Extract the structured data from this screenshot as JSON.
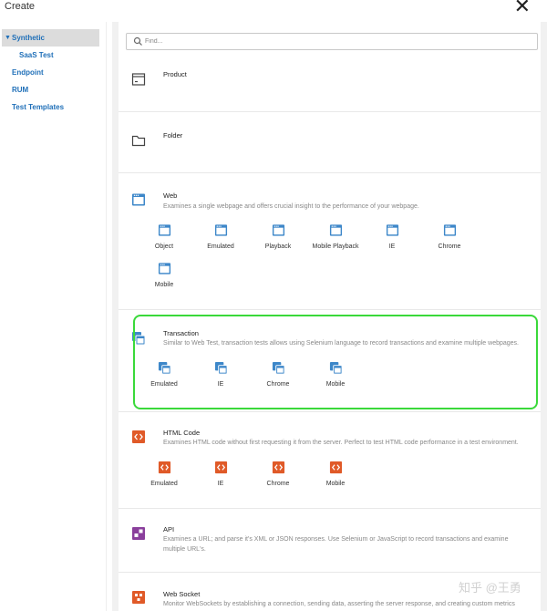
{
  "window": {
    "title": "Create"
  },
  "sidebar": {
    "items": [
      {
        "label": "Synthetic"
      },
      {
        "label": "SaaS Test"
      },
      {
        "label": "Endpoint"
      },
      {
        "label": "RUM"
      },
      {
        "label": "Test Templates"
      }
    ]
  },
  "search": {
    "placeholder": "Find..."
  },
  "sections": {
    "product": {
      "title": "Product"
    },
    "folder": {
      "title": "Folder"
    },
    "web": {
      "title": "Web",
      "description": "Examines a single webpage and offers crucial insight to the performance of your webpage.",
      "tiles": [
        "Object",
        "Emulated",
        "Playback",
        "Mobile Playback",
        "IE",
        "Chrome",
        "Mobile"
      ]
    },
    "transaction": {
      "title": "Transaction",
      "description": "Similar to Web Test, transaction tests allows using Selenium language to record transactions and examine multiple webpages.",
      "tiles": [
        "Emulated",
        "IE",
        "Chrome",
        "Mobile"
      ]
    },
    "html_code": {
      "title": "HTML Code",
      "description": "Examines HTML code without first requesting it from the server. Perfect to test HTML code performance in a test environment.",
      "tiles": [
        "Emulated",
        "IE",
        "Chrome",
        "Mobile"
      ]
    },
    "api": {
      "title": "API",
      "description": "Examines a URL; and parse it's XML or JSON responses. Use Selenium or JavaScript to record transactions and examine multiple URL's."
    },
    "websocket": {
      "title": "Web Socket",
      "description": "Monitor WebSockets by establishing a connection, sending data, asserting the server response, and creating custom metrics"
    }
  },
  "watermark": "知乎 @王勇",
  "colors": {
    "link": "#1f6fb8",
    "web_icon": "#3d87c9",
    "html_icon": "#e05a28",
    "api_icon": "#8a3f9c",
    "highlight": "#3ad93a"
  }
}
